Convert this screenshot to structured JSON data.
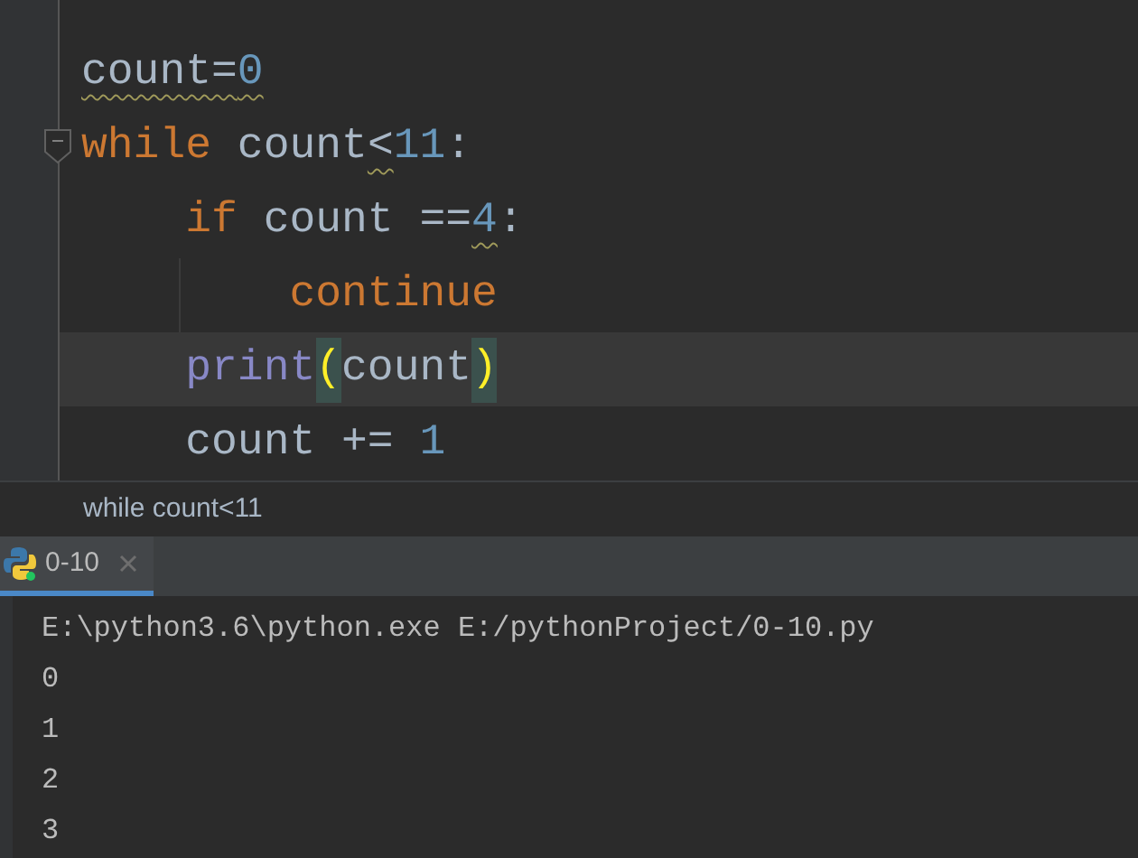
{
  "editor": {
    "lines": [
      {
        "current": false,
        "tokens": [
          {
            "kind": "ident",
            "text": "count=",
            "warning": true
          },
          {
            "kind": "number",
            "text": "0",
            "warning": true
          }
        ]
      },
      {
        "current": false,
        "fold": true,
        "tokens": [
          {
            "kind": "keyword",
            "text": "while",
            "warning": false
          },
          {
            "kind": "ident",
            "text": " count",
            "warning": false
          },
          {
            "kind": "ident",
            "text": "<",
            "warning": true
          },
          {
            "kind": "number",
            "text": "11",
            "warning": false
          },
          {
            "kind": "ident",
            "text": ":",
            "warning": false
          }
        ]
      },
      {
        "current": false,
        "tokens": [
          {
            "kind": "keyword",
            "text": "    if",
            "warning": false
          },
          {
            "kind": "ident",
            "text": " count ==",
            "warning": false
          },
          {
            "kind": "number",
            "text": "4",
            "warning": true
          },
          {
            "kind": "ident",
            "text": ":",
            "warning": false
          }
        ]
      },
      {
        "current": false,
        "tokens": [
          {
            "kind": "keyword",
            "text": "        continue",
            "warning": false
          }
        ]
      },
      {
        "current": true,
        "tokens": [
          {
            "kind": "builtin",
            "text": "    print",
            "warning": false
          },
          {
            "kind": "paren",
            "text": "(",
            "warning": false
          },
          {
            "kind": "ident",
            "text": "count",
            "warning": false
          },
          {
            "kind": "paren",
            "text": ")",
            "warning": false
          }
        ]
      },
      {
        "current": false,
        "tokens": [
          {
            "kind": "ident",
            "text": "    count += ",
            "warning": false
          },
          {
            "kind": "number",
            "text": "1",
            "warning": false
          }
        ]
      }
    ]
  },
  "breadcrumb": "while count<11",
  "run_tab": {
    "label": "0-10",
    "selected": true
  },
  "console": [
    "E:\\python3.6\\python.exe E:/pythonProject/0-10.py",
    "0",
    "1",
    "2",
    "3"
  ]
}
